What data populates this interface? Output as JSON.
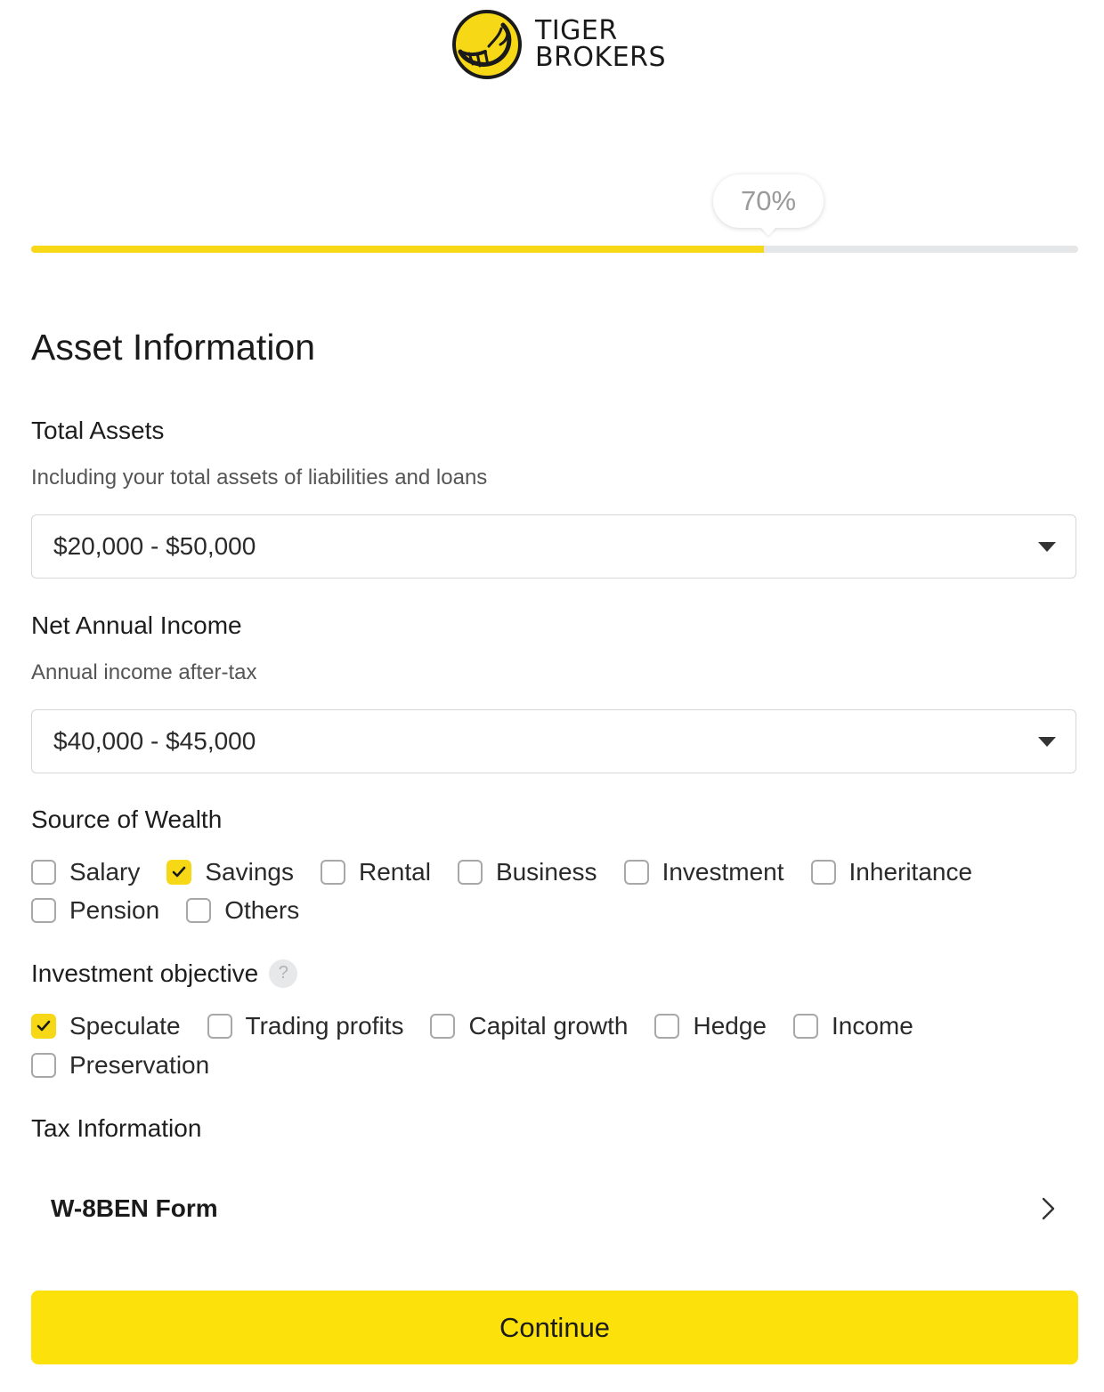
{
  "brand": {
    "name_line1": "TIGER",
    "name_line2": "BROKERS",
    "accent_color": "#f7d816"
  },
  "progress": {
    "label": "70%",
    "value": 70
  },
  "page_title": "Asset Information",
  "total_assets": {
    "label": "Total Assets",
    "hint": "Including your total assets of liabilities and loans",
    "selected": "$20,000 - $50,000"
  },
  "net_income": {
    "label": "Net Annual Income",
    "hint": "Annual income after-tax",
    "selected": "$40,000 - $45,000"
  },
  "source_of_wealth": {
    "label": "Source of Wealth",
    "options": [
      {
        "label": "Salary",
        "checked": false
      },
      {
        "label": "Savings",
        "checked": true
      },
      {
        "label": "Rental",
        "checked": false
      },
      {
        "label": "Business",
        "checked": false
      },
      {
        "label": "Investment",
        "checked": false
      },
      {
        "label": "Inheritance",
        "checked": false
      },
      {
        "label": "Pension",
        "checked": false
      },
      {
        "label": "Others",
        "checked": false
      }
    ]
  },
  "investment_objective": {
    "label": "Investment objective",
    "help_symbol": "?",
    "options": [
      {
        "label": "Speculate",
        "checked": true
      },
      {
        "label": "Trading profits",
        "checked": false
      },
      {
        "label": "Capital growth",
        "checked": false
      },
      {
        "label": "Hedge",
        "checked": false
      },
      {
        "label": "Income",
        "checked": false
      },
      {
        "label": "Preservation",
        "checked": false
      }
    ]
  },
  "tax_information": {
    "label": "Tax Information",
    "form_label": "W-8BEN Form"
  },
  "continue_label": "Continue"
}
